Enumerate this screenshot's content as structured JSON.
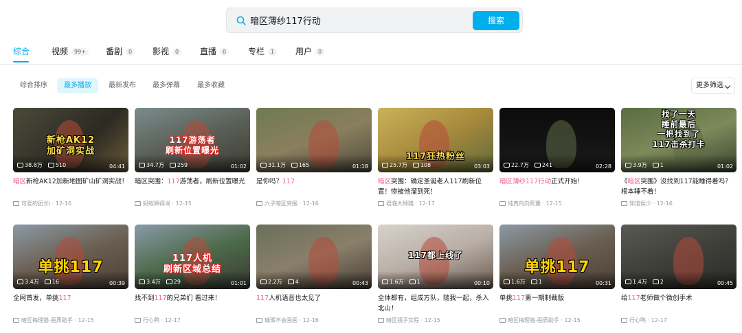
{
  "search": {
    "query": "暗区薄纱117行动",
    "button": "搜索"
  },
  "tabs": [
    {
      "label": "综合",
      "count": ""
    },
    {
      "label": "视频",
      "count": "99+"
    },
    {
      "label": "番剧",
      "count": "0"
    },
    {
      "label": "影视",
      "count": "0"
    },
    {
      "label": "直播",
      "count": "0"
    },
    {
      "label": "专栏",
      "count": "1"
    },
    {
      "label": "用户",
      "count": "0"
    }
  ],
  "sorts": [
    "综合排序",
    "最多播放",
    "最新发布",
    "最多弹幕",
    "最多收藏"
  ],
  "more_filter": "更多筛选",
  "colors": {
    "accent": "#00aeec",
    "highlight": "#f25d8e"
  },
  "videos": [
    {
      "caption": "新枪AK12\n加矿洞实战",
      "views": "38.8万",
      "danmaku": "510",
      "duration": "04:41",
      "title_hl": "暗区",
      "title_rest": "新枪AK12加新地图矿山矿洞实战！",
      "author": "可爱的团长i",
      "date": "12-16"
    },
    {
      "caption": "117游荡者\n刷新位置曝光",
      "views": "34.7万",
      "danmaku": "259",
      "duration": "01:02",
      "title_pre": "暗区突围：",
      "title_hl": "117",
      "title_rest": "游荡者，刷新位置曝光",
      "author": "蚂蚁狮得说",
      "date": "12-15"
    },
    {
      "caption": "",
      "views": "31.1万",
      "danmaku": "165",
      "duration": "01:18",
      "title_pre": "是你吗？",
      "title_hl": "117",
      "title_rest": "",
      "author": "六子暗区突围",
      "date": "12-16"
    },
    {
      "caption": "117狂热粉丝",
      "views": "25.7万",
      "danmaku": "108",
      "duration": "03:03",
      "title_hl": "暗区",
      "title_rest": "突围：确定圣诞老人117刷新位置！惨被他溜到死！",
      "author": "君临大師踏",
      "date": "12-17"
    },
    {
      "caption": "",
      "views": "22.7万",
      "danmaku": "241",
      "duration": "02:28",
      "title_hl": "暗区薄纱117行动",
      "title_rest": "正式开始！",
      "author": "纯真的向死囊",
      "date": "12-15"
    },
    {
      "caption": "找了一天\n睡前最后\n一把找到了\n117击杀打卡",
      "views": "3.9万",
      "danmaku": "1",
      "duration": "01:02",
      "title_pre": "《",
      "title_hl": "暗区",
      "title_rest": "突围》没找到117能睡得着吗？根本睡不着！",
      "author": "知道侯少",
      "date": "12-16"
    },
    {
      "caption": "单挑117",
      "views": "3.4万",
      "danmaku": "16",
      "duration": "00:39",
      "title_pre": "全网首发，单挑",
      "title_hl": "117",
      "title_rest": "",
      "author": "暗区梅理猫-画质助手",
      "date": "12-15"
    },
    {
      "caption": "117人机\n刷新区域总结",
      "views": "3.4万",
      "danmaku": "29",
      "duration": "01:01",
      "title_pre": "找不到",
      "title_hl": "117",
      "title_rest": "的兄弟们 看过来！",
      "author": "行心鸭",
      "date": "12-17"
    },
    {
      "caption": "",
      "views": "2.2万",
      "danmaku": "4",
      "duration": "00:43",
      "title_hl": "117",
      "title_rest": "人机语音也太见了",
      "author": "璀璨不会画画",
      "date": "12-16"
    },
    {
      "caption": "117都上线了",
      "views": "1.6万",
      "danmaku": "1",
      "duration": "00:10",
      "title_pre": "全体都有，组成方队，随我一起，杀入北山！",
      "title_hl": "",
      "title_rest": "",
      "author": "暗区镜子实程",
      "date": "12-15"
    },
    {
      "caption": "单挑117",
      "views": "1.6万",
      "danmaku": "1",
      "duration": "00:31",
      "title_pre": "单挑",
      "title_hl": "117",
      "title_rest": "第一期制裁版",
      "author": "暗区梅理猫-画质助手",
      "date": "12-15"
    },
    {
      "caption": "",
      "views": "1.4万",
      "danmaku": "2",
      "duration": "00:45",
      "title_pre": "给",
      "title_hl": "117",
      "title_rest": "老师做个微创手术",
      "author": "行心鸭",
      "date": "12-17"
    }
  ]
}
